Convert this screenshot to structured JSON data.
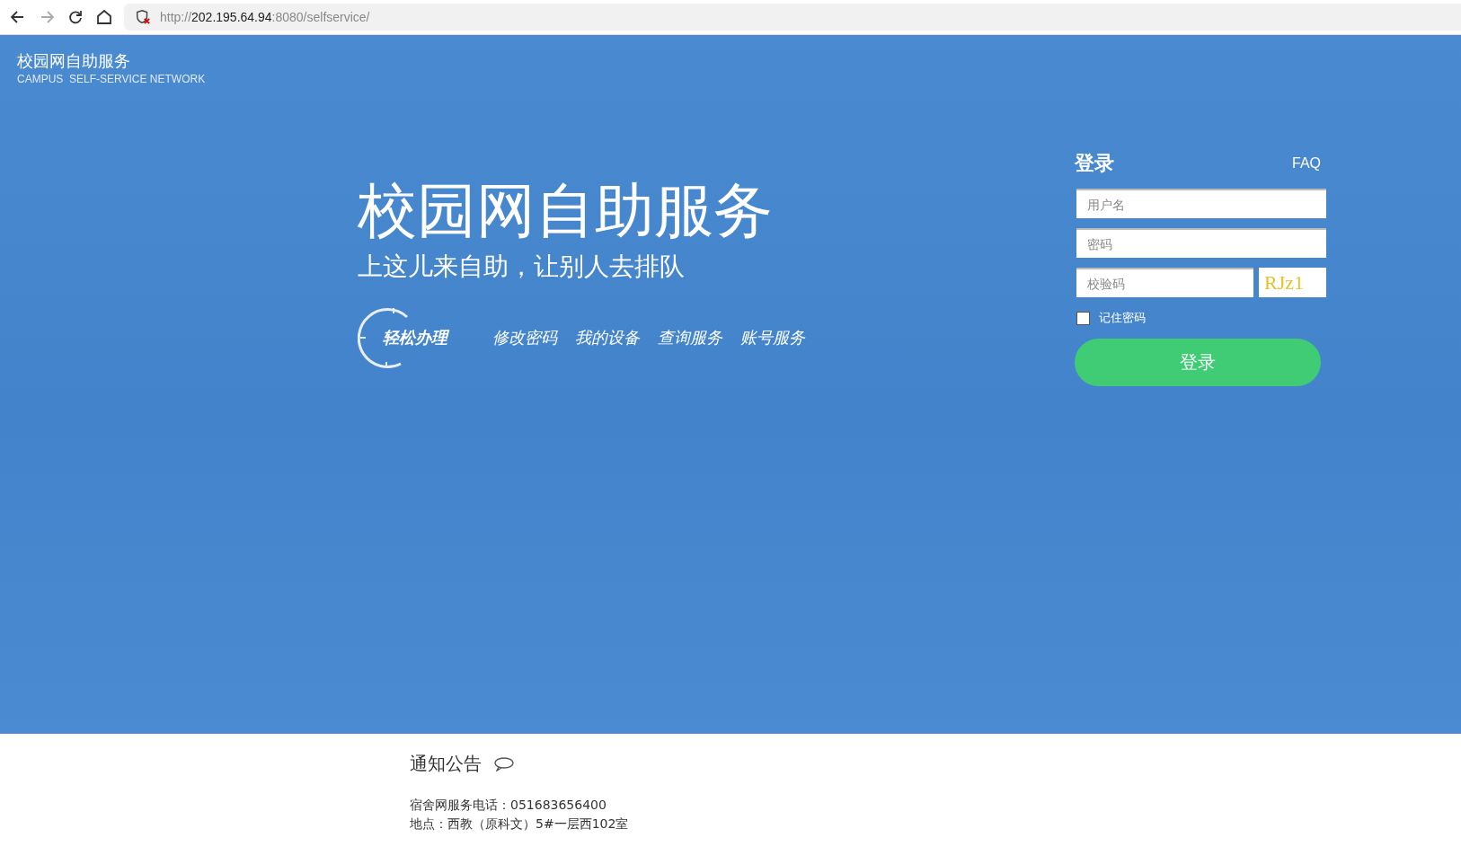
{
  "browser": {
    "url": {
      "prefix": "http://",
      "host": "202.195.64.94",
      "suffix": ":8080/selfservice/"
    }
  },
  "logo": {
    "title": "校园网自助服务",
    "subtitle": "CAMPUS  SELF-SERVICE NETWORK"
  },
  "hero": {
    "title": "校园网自助服务",
    "slogan": "上这儿来自助，让别人去排队",
    "badge": "轻松办理",
    "links": [
      "修改密码",
      "我的设备",
      "查询服务",
      "账号服务"
    ]
  },
  "login": {
    "title": "登录",
    "faq": "FAQ",
    "username": {
      "placeholder": "用户名"
    },
    "password": {
      "placeholder": "密码"
    },
    "captcha": {
      "placeholder": "校验码",
      "code": "RJz1"
    },
    "remember": {
      "label": "记住密码",
      "checked": false
    },
    "submit": "登录"
  },
  "notice": {
    "title": "通知公告",
    "lines": [
      "宿舍网服务电话：051683656400",
      "地点：西教（原科文）5#一层西102室"
    ]
  }
}
